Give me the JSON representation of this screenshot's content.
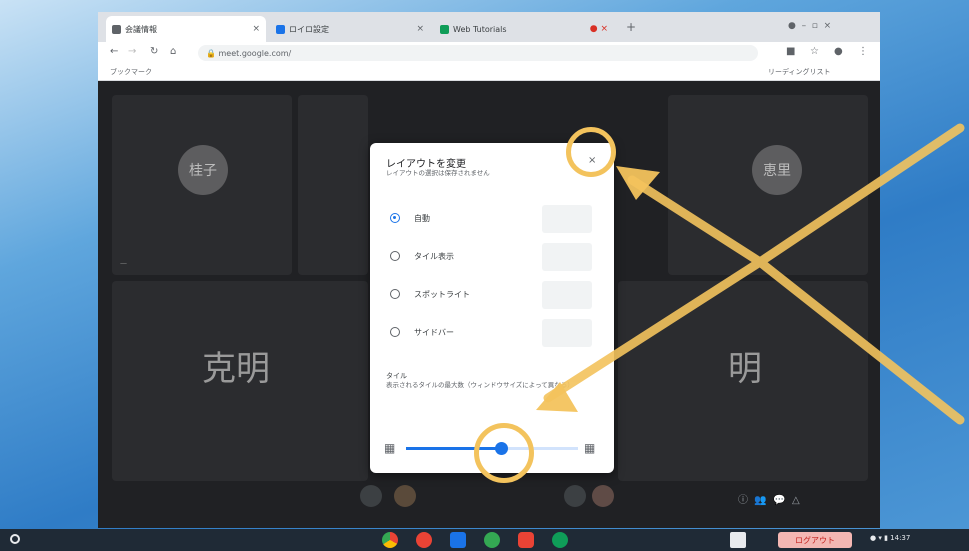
{
  "tabs": [
    {
      "label": "会議情報",
      "color": "#5f6368"
    },
    {
      "label": "ロイロ設定",
      "color": "#1a73e8"
    },
    {
      "label": "Web Tutorials",
      "color": "#0f9d58"
    }
  ],
  "toolbar": {
    "url": "meet.google.com/",
    "bookmarks_label": "ブックマーク",
    "reading_list": "リーディングリスト"
  },
  "participants": {
    "top_left_avatar": "桂子",
    "top_right_avatar": "恵里",
    "bottom_left_name": "克明",
    "bottom_right_name": "明"
  },
  "dialog": {
    "title": "レイアウトを変更",
    "description": "レイアウトの選択は保存されません",
    "close_icon": "×",
    "options": [
      {
        "label": "自動",
        "selected": true
      },
      {
        "label": "タイル表示",
        "selected": false
      },
      {
        "label": "スポットライト",
        "selected": false
      },
      {
        "label": "サイドバー",
        "selected": false
      }
    ],
    "tiles_label": "タイル",
    "tiles_desc": "表示されるタイルの最大数（ウィンドウサイズによって異なる）",
    "slider_value": 0.55
  },
  "shelf": {
    "logout_label": "ログアウト",
    "time": "14:37"
  },
  "colors": {
    "accent": "#1a73e8",
    "annotation": "#f3c35d"
  }
}
